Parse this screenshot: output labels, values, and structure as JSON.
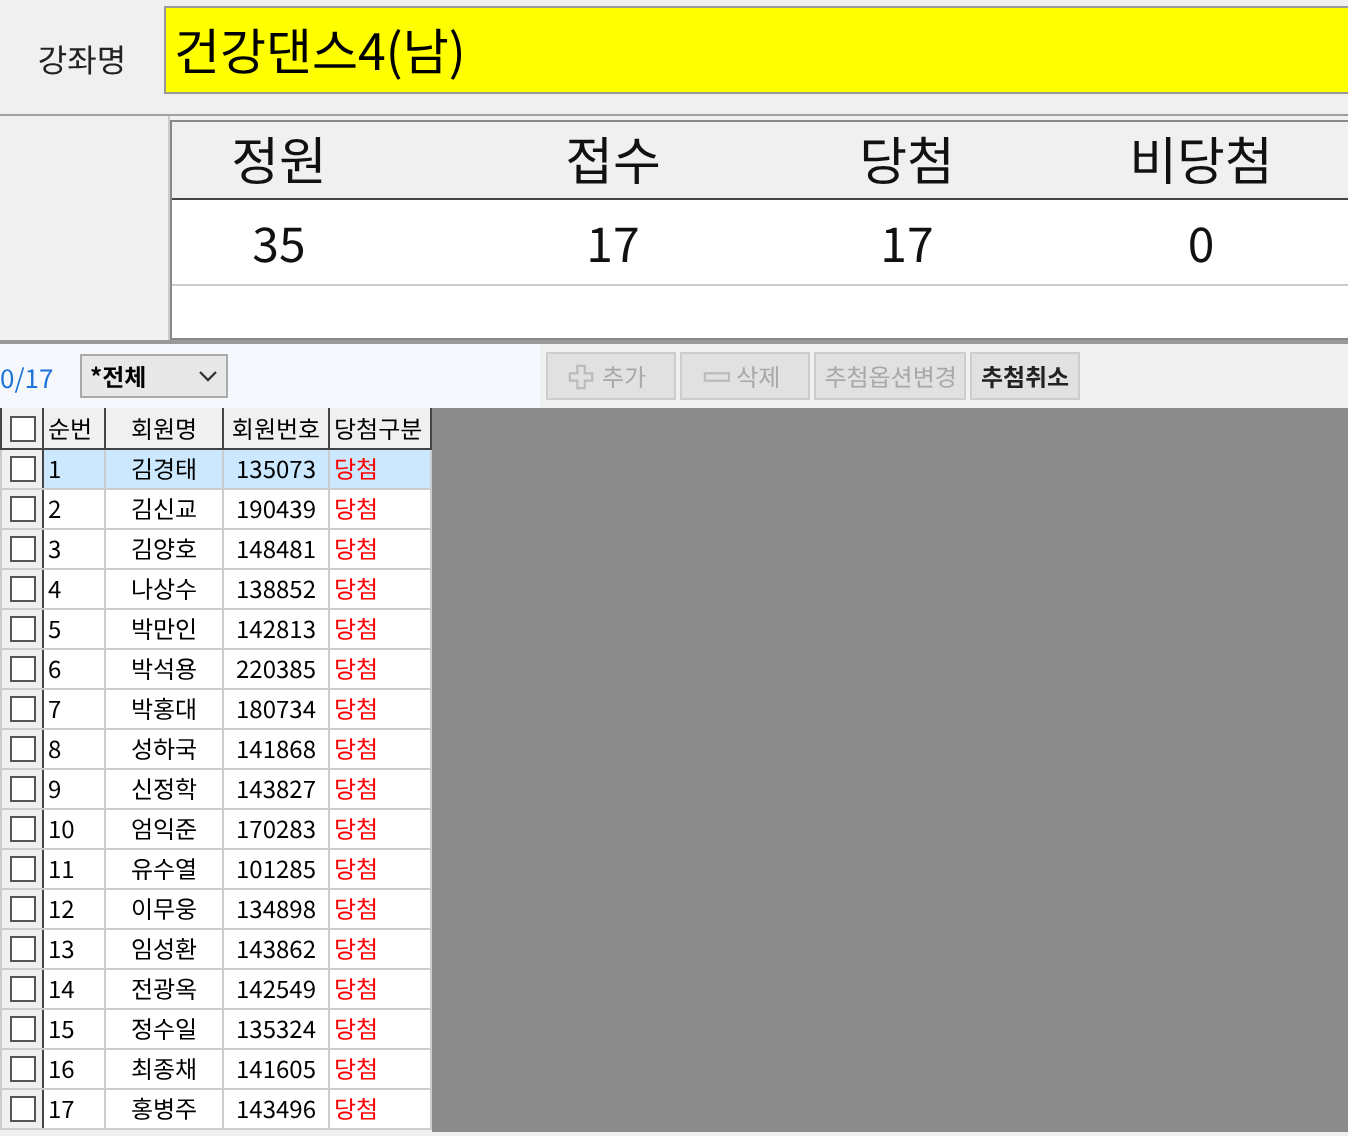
{
  "course": {
    "label": "강좌명",
    "value": "건강댄스4(남)"
  },
  "stats": [
    {
      "header": "정원",
      "value": "35"
    },
    {
      "header": "접수",
      "value": "17"
    },
    {
      "header": "당첨",
      "value": "17"
    },
    {
      "header": "비당첨",
      "value": "0"
    }
  ],
  "toolbar": {
    "count": "0/17",
    "filter": "*전체",
    "buttons": [
      {
        "label": "추가",
        "kind": "add",
        "disabled": true
      },
      {
        "label": "삭제",
        "kind": "remove",
        "disabled": true
      },
      {
        "label": "추첨옵션변경",
        "kind": "text",
        "disabled": true
      },
      {
        "label": "추첨취소",
        "kind": "text",
        "disabled": false
      }
    ]
  },
  "table": {
    "header_checked": false,
    "columns": [
      "순번",
      "회원명",
      "회원번호",
      "당첨구분"
    ],
    "rows": [
      {
        "selected": true,
        "checked": false,
        "cells": [
          "1",
          "김경태",
          "135073",
          "당첨"
        ]
      },
      {
        "selected": false,
        "checked": false,
        "cells": [
          "2",
          "김신교",
          "190439",
          "당첨"
        ]
      },
      {
        "selected": false,
        "checked": false,
        "cells": [
          "3",
          "김양호",
          "148481",
          "당첨"
        ]
      },
      {
        "selected": false,
        "checked": false,
        "cells": [
          "4",
          "나상수",
          "138852",
          "당첨"
        ]
      },
      {
        "selected": false,
        "checked": false,
        "cells": [
          "5",
          "박만인",
          "142813",
          "당첨"
        ]
      },
      {
        "selected": false,
        "checked": false,
        "cells": [
          "6",
          "박석용",
          "220385",
          "당첨"
        ]
      },
      {
        "selected": false,
        "checked": false,
        "cells": [
          "7",
          "박홍대",
          "180734",
          "당첨"
        ]
      },
      {
        "selected": false,
        "checked": false,
        "cells": [
          "8",
          "성하국",
          "141868",
          "당첨"
        ]
      },
      {
        "selected": false,
        "checked": false,
        "cells": [
          "9",
          "신정학",
          "143827",
          "당첨"
        ]
      },
      {
        "selected": false,
        "checked": false,
        "cells": [
          "10",
          "엄익준",
          "170283",
          "당첨"
        ]
      },
      {
        "selected": false,
        "checked": false,
        "cells": [
          "11",
          "유수열",
          "101285",
          "당첨"
        ]
      },
      {
        "selected": false,
        "checked": false,
        "cells": [
          "12",
          "이무웅",
          "134898",
          "당첨"
        ]
      },
      {
        "selected": false,
        "checked": false,
        "cells": [
          "13",
          "임성환",
          "143862",
          "당첨"
        ]
      },
      {
        "selected": false,
        "checked": false,
        "cells": [
          "14",
          "전광옥",
          "142549",
          "당첨"
        ]
      },
      {
        "selected": false,
        "checked": false,
        "cells": [
          "15",
          "정수일",
          "135324",
          "당첨"
        ]
      },
      {
        "selected": false,
        "checked": false,
        "cells": [
          "16",
          "최종채",
          "141605",
          "당첨"
        ]
      },
      {
        "selected": false,
        "checked": false,
        "cells": [
          "17",
          "홍병주",
          "143496",
          "당첨"
        ]
      }
    ]
  }
}
